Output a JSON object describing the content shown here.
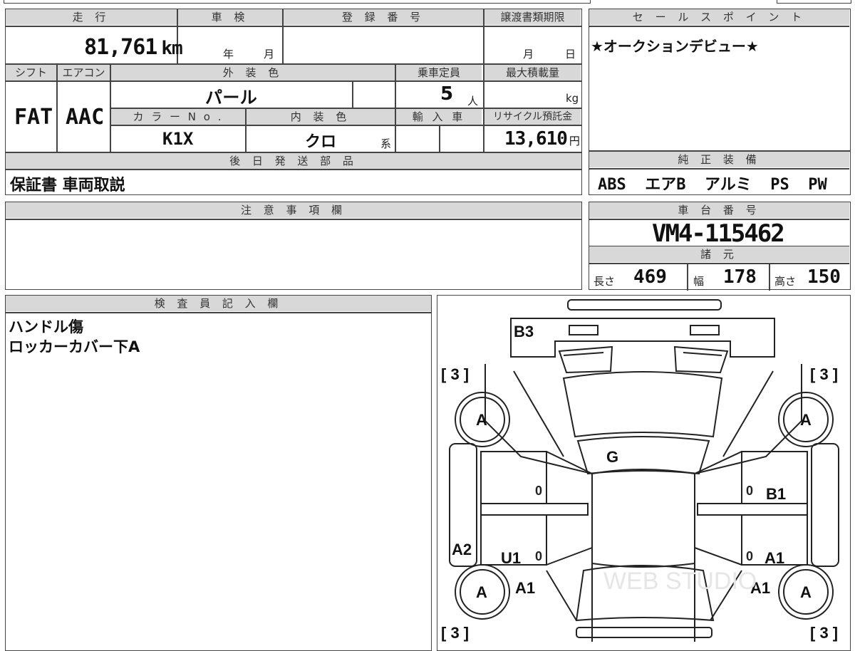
{
  "info": {
    "mileage_label": "走 行",
    "mileage": "81,761",
    "mileage_unit": "km",
    "inspection_label": "車 検",
    "inspection_year": "年",
    "inspection_month": "月",
    "registration_label": "登 録 番 号",
    "transfer_label": "譲渡書類期限",
    "transfer_month": "月",
    "transfer_day": "日",
    "shift_label": "シフト",
    "shift": "FAT",
    "aircon_label": "エアコン",
    "aircon": "AAC",
    "exterior_label": "外 装 色",
    "exterior": "パ ー ル",
    "capacity_label": "乗車定員",
    "capacity": "5",
    "capacity_unit": "人",
    "maxload_label": "最大積載量",
    "maxload_unit": "kg",
    "color_no_label": "カ ラ ー N o .",
    "color_no": "K1X",
    "interior_label": "内 装 色",
    "interior": "クロ",
    "interior_suffix": "系",
    "import_label": "輸 入 車",
    "recycle_label": "リサイクル預託金",
    "recycle": "13,610",
    "recycle_unit": "円",
    "later_parts_label": "後 日 発 送 部 品",
    "later_parts": "保証書 車両取説"
  },
  "sales": {
    "label": "セ ー ル ス ポ イ ン ト",
    "text": "★オークションデビュー★"
  },
  "equipment": {
    "label": "純 正 装 備",
    "text": "ABS  エアB  アルミ  PS  PW"
  },
  "caution": {
    "label": "注 意 事 項 欄"
  },
  "chassis": {
    "label": "車 台 番 号",
    "value": "VM4-115462"
  },
  "specs": {
    "label": "諸 元",
    "length_label": "長さ",
    "length": "469",
    "width_label": "幅",
    "width": "178",
    "height_label": "高さ",
    "height": "150"
  },
  "inspector": {
    "label": "検 査 員 記 入 欄",
    "line1": "ハンドル傷",
    "line2": "ロッカーカバー下A"
  },
  "diagram": {
    "b3": "B3",
    "tire_fl": "[ 3 ]",
    "tire_fr": "[ 3 ]",
    "tire_rl": "[ 3 ]",
    "tire_rr": "[ 3 ]",
    "wheel_a": "A",
    "g": "G",
    "b1": "B1",
    "a2": "A2",
    "u1": "U1",
    "a1": "A1",
    "zero": "0",
    "watermark": "WEB STUDIO"
  }
}
